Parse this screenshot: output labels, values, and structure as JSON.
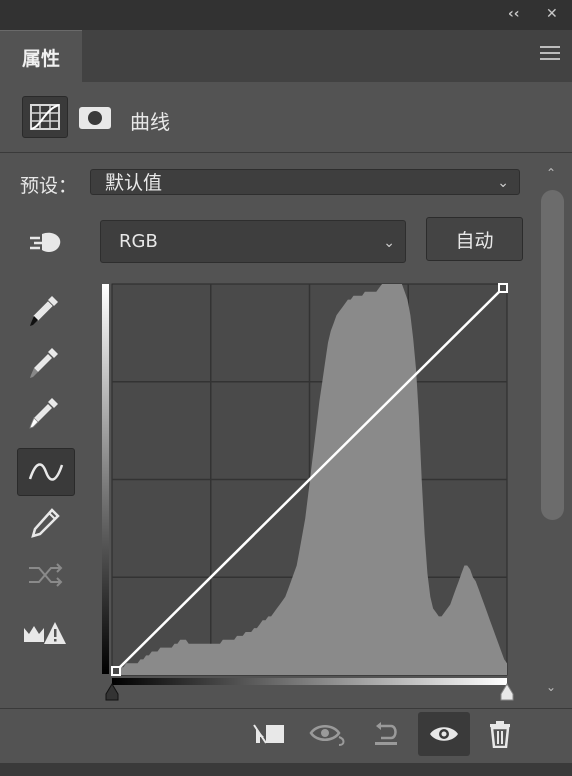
{
  "window": {
    "collapse_glyph": "‹‹",
    "close_glyph": "✕"
  },
  "tab": {
    "label": "属性"
  },
  "header": {
    "adjustment_title": "曲线"
  },
  "preset": {
    "label": "预设：",
    "value": "默认值"
  },
  "channel": {
    "value": "RGB"
  },
  "auto_button": {
    "label": "自动"
  },
  "curve": {
    "points": [
      [
        0,
        0
      ],
      [
        255,
        255
      ]
    ],
    "histogram": [
      1,
      1,
      2,
      2,
      2,
      3,
      3,
      3,
      3,
      3,
      4,
      4,
      5,
      5,
      6,
      6,
      6,
      7,
      7,
      7,
      7,
      7,
      8,
      8,
      9,
      9,
      9,
      8,
      8,
      8,
      8,
      8,
      8,
      8,
      8,
      8,
      8,
      8,
      8,
      9,
      9,
      9,
      9,
      9,
      10,
      10,
      10,
      11,
      11,
      11,
      12,
      12,
      13,
      14,
      14,
      15,
      15,
      16,
      17,
      18,
      19,
      20,
      22,
      24,
      26,
      28,
      32,
      36,
      40,
      46,
      52,
      58,
      64,
      70,
      75,
      80,
      85,
      88,
      90,
      92,
      93,
      94,
      95,
      96,
      96,
      97,
      97,
      97,
      97,
      98,
      98,
      98,
      98,
      98,
      99,
      100,
      100,
      100,
      100,
      100,
      100,
      100,
      100,
      98,
      96,
      92,
      86,
      78,
      66,
      50,
      36,
      26,
      20,
      17,
      16,
      15,
      15,
      16,
      17,
      18,
      20,
      22,
      24,
      26,
      28,
      28,
      27,
      25,
      24,
      22,
      20,
      18,
      16,
      14,
      12,
      10,
      8,
      6,
      4,
      3
    ]
  },
  "tools": [
    {
      "name": "on-image-adjust-icon"
    },
    {
      "name": "black-point-eyedropper-icon"
    },
    {
      "name": "gray-point-eyedropper-icon"
    },
    {
      "name": "white-point-eyedropper-icon"
    },
    {
      "name": "curve-edit-icon"
    },
    {
      "name": "pencil-icon"
    },
    {
      "name": "smooth-curve-icon"
    },
    {
      "name": "clipping-warning-icon"
    }
  ],
  "bottom_buttons": [
    {
      "name": "clip-to-layer-icon"
    },
    {
      "name": "view-previous-state-icon"
    },
    {
      "name": "reset-icon"
    },
    {
      "name": "visibility-eye-icon"
    },
    {
      "name": "trash-icon"
    }
  ],
  "colors": {
    "panel": "#535353",
    "dark": "#3e3e3e",
    "graph_bg": "#4a4a4a",
    "histogram": "#8a8a8a",
    "curve": "#ffffff"
  }
}
